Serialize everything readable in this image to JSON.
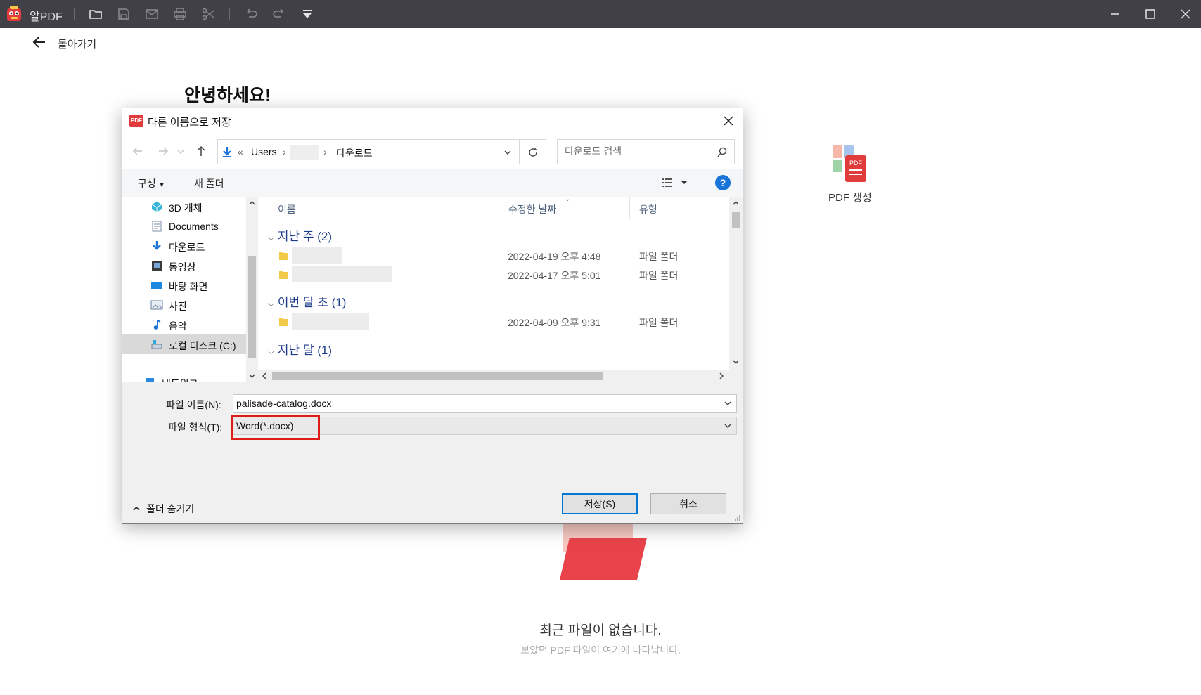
{
  "app": {
    "name": "알PDF",
    "back_label": "돌아가기",
    "greeting": "안녕하세요!",
    "pdf_create_label": "PDF 생성",
    "empty_title": "최근 파일이 없습니다.",
    "empty_subtitle": "보았던 PDF 파일이 여기에 나타납니다.",
    "accent_color": "#e23b3b"
  },
  "dialog": {
    "title": "다른 이름으로 저장",
    "icon_text": "PDF",
    "address": {
      "prefix": "«",
      "segments": [
        "Users",
        "다운로드"
      ]
    },
    "search_placeholder": "다운로드 검색",
    "toolbar": {
      "organize": "구성",
      "new_folder": "새 폴더",
      "help": "?"
    },
    "tree": [
      {
        "label": "3D 개체",
        "icon": "cube-icon"
      },
      {
        "label": "Documents",
        "icon": "document-icon"
      },
      {
        "label": "다운로드",
        "icon": "download-icon"
      },
      {
        "label": "동영상",
        "icon": "video-icon"
      },
      {
        "label": "바탕 화면",
        "icon": "desktop-icon"
      },
      {
        "label": "사진",
        "icon": "picture-icon"
      },
      {
        "label": "음악",
        "icon": "music-icon"
      },
      {
        "label": "로컬 디스크 (C:)",
        "icon": "drive-icon",
        "selected": true
      },
      {
        "label": "네트워크",
        "icon": "network-icon"
      }
    ],
    "columns": {
      "name": "이름",
      "modified": "수정한 날짜",
      "type": "유형"
    },
    "groups": [
      {
        "title": "지난 주 (2)",
        "rows": [
          {
            "date": "2022-04-19 오후 4:48",
            "type": "파일 폴더"
          },
          {
            "date": "2022-04-17 오후 5:01",
            "type": "파일 폴더"
          }
        ]
      },
      {
        "title": "이번 달 초 (1)",
        "rows": [
          {
            "date": "2022-04-09 오후 9:31",
            "type": "파일 폴더"
          }
        ]
      },
      {
        "title": "지난 달 (1)",
        "rows": []
      }
    ],
    "filename_label": "파일 이름(N):",
    "filename_value": "palisade-catalog.docx",
    "filetype_label": "파일 형식(T):",
    "filetype_value": "Word(*.docx)",
    "hide_folders": "폴더 숨기기",
    "save_button": "저장(S)",
    "cancel_button": "취소"
  }
}
